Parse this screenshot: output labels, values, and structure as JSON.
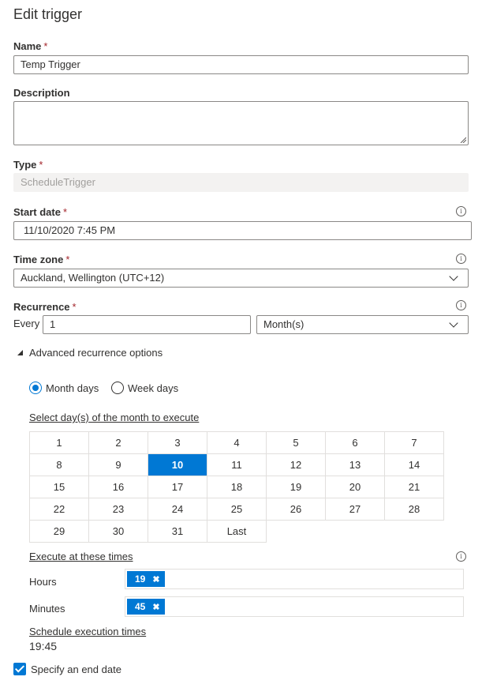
{
  "title": "Edit trigger",
  "name": {
    "label": "Name",
    "required_mark": "*",
    "value": "Temp Trigger"
  },
  "description": {
    "label": "Description",
    "value": ""
  },
  "type": {
    "label": "Type",
    "required_mark": "*",
    "value": "ScheduleTrigger"
  },
  "start_date": {
    "label": "Start date",
    "required_mark": "*",
    "value": "11/10/2020 7:45 PM",
    "info_icon": "info-icon"
  },
  "time_zone": {
    "label": "Time zone",
    "required_mark": "*",
    "value": "Auckland, Wellington (UTC+12)",
    "info_icon": "info-icon"
  },
  "recurrence": {
    "label": "Recurrence",
    "required_mark": "*",
    "every_label": "Every",
    "interval": "1",
    "unit": "Month(s)"
  },
  "advanced": {
    "toggle_label": "Advanced recurrence options",
    "expanded": true
  },
  "mode": {
    "options": [
      {
        "label": "Month days",
        "selected": true
      },
      {
        "label": "Week days",
        "selected": false
      }
    ]
  },
  "month_days": {
    "heading": "Select day(s) of the month to execute",
    "rows": [
      [
        "1",
        "2",
        "3",
        "4",
        "5",
        "6",
        "7"
      ],
      [
        "8",
        "9",
        "10",
        "11",
        "12",
        "13",
        "14"
      ],
      [
        "15",
        "16",
        "17",
        "18",
        "19",
        "20",
        "21"
      ],
      [
        "22",
        "23",
        "24",
        "25",
        "26",
        "27",
        "28"
      ],
      [
        "29",
        "30",
        "31",
        "Last"
      ]
    ],
    "selected": [
      "10"
    ]
  },
  "execute_times": {
    "heading": "Execute at these times",
    "hours_label": "Hours",
    "hours_tags": [
      "19"
    ],
    "minutes_label": "Minutes",
    "minutes_tags": [
      "45"
    ]
  },
  "schedule": {
    "heading": "Schedule execution times",
    "value": "19:45"
  },
  "end_date": {
    "label": "Specify an end date",
    "checked": true
  },
  "colors": {
    "accent": "#0078d4",
    "required": "#a4262c",
    "border": "#8a8886"
  }
}
